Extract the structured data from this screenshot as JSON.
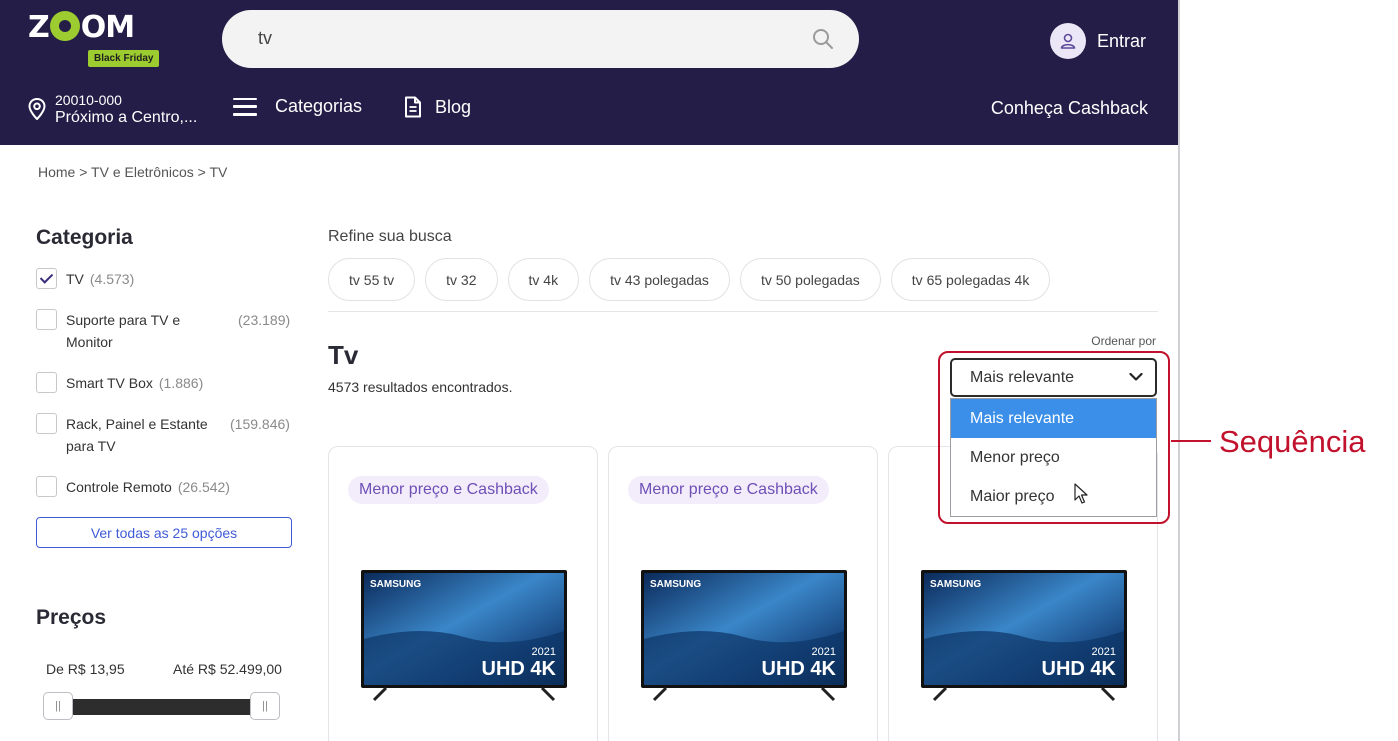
{
  "header": {
    "logo_text_pre": "Z",
    "logo_text_post": "OM",
    "logo_badge": "Black Friday",
    "search_value": "tv",
    "login_label": "Entrar",
    "location_cep": "20010-000",
    "location_addr": "Próximo a Centro,...",
    "nav_categories": "Categorias",
    "nav_blog": "Blog",
    "cashback_link": "Conheça Cashback",
    "colors": {
      "bg": "#241d47",
      "accent": "#9ccc2f"
    }
  },
  "breadcrumb": "Home > TV e Eletrônicos > TV",
  "sidebar": {
    "category_title": "Categoria",
    "filters": [
      {
        "label": "TV",
        "count": "(4.573)",
        "checked": true
      },
      {
        "label": "Suporte para TV e Monitor",
        "count": "(23.189)",
        "checked": false
      },
      {
        "label": "Smart TV Box",
        "count": "(1.886)",
        "checked": false
      },
      {
        "label": "Rack, Painel e Estante para TV",
        "count": "(159.846)",
        "checked": false
      },
      {
        "label": "Controle Remoto",
        "count": "(26.542)",
        "checked": false
      }
    ],
    "see_all": "Ver todas as 25 opções",
    "price_title": "Preços",
    "price_min": "De R$ 13,95",
    "price_max": "Até R$ 52.499,00"
  },
  "main": {
    "refine_label": "Refine sua busca",
    "chips": [
      "tv 55 tv",
      "tv 32",
      "tv 4k",
      "tv 43 polegadas",
      "tv 50 polegadas",
      "tv 65 polegadas 4k"
    ],
    "title": "Tv",
    "result_count": "4573 resultados encontrados.",
    "sort": {
      "label": "Ordenar por",
      "selected": "Mais relevante",
      "options": [
        "Mais relevante",
        "Menor preço",
        "Maior preço"
      ]
    },
    "annotation": "Sequência",
    "cards": [
      {
        "badge": "Menor preço e Cashback",
        "brand": "SAMSUNG",
        "year": "2021",
        "tag": "UHD 4K"
      },
      {
        "badge": "Menor preço e Cashback",
        "brand": "SAMSUNG",
        "year": "2021",
        "tag": "UHD 4K"
      },
      {
        "badge": "",
        "brand": "SAMSUNG",
        "year": "2021",
        "tag": "UHD 4K"
      }
    ]
  }
}
